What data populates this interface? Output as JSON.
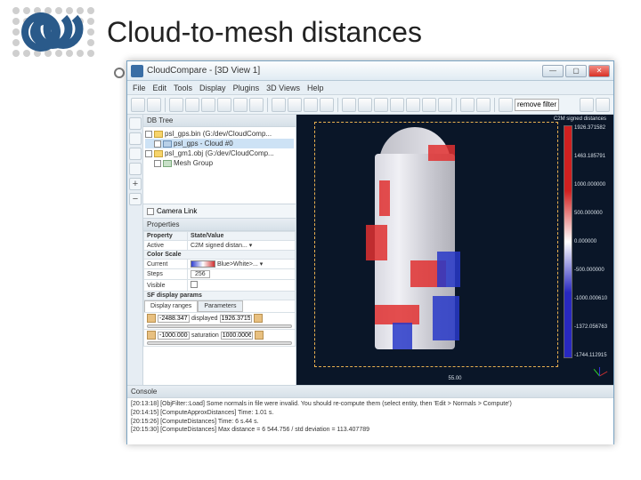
{
  "slide": {
    "title": "Cloud-to-mesh distances"
  },
  "window": {
    "title": "CloudCompare - [3D View 1]"
  },
  "menu": [
    "File",
    "Edit",
    "Tools",
    "Display",
    "Plugins",
    "3D Views",
    "Help"
  ],
  "toolbar_filter": "remove filter",
  "panels": {
    "tree_title": "DB Tree",
    "properties_title": "Properties",
    "console_title": "Console",
    "camera_link_label": "Camera Link"
  },
  "tree": [
    {
      "label": "psl_gps.bin (G:/dev/CloudComp...",
      "indent": 0,
      "icon": "folder"
    },
    {
      "label": "psl_gps - Cloud #0",
      "indent": 1,
      "icon": "cloud",
      "selected": true
    },
    {
      "label": "psl_gm1.obj (G:/dev/CloudComp...",
      "indent": 0,
      "icon": "folder"
    },
    {
      "label": "Mesh Group",
      "indent": 1,
      "icon": "mesh"
    }
  ],
  "properties": {
    "headers": [
      "Property",
      "State/Value"
    ],
    "active_label": "Active",
    "active_value": "C2M signed distan...",
    "colorscale_label": "Color Scale",
    "current_label": "Current",
    "current_value": "Blue>White>...",
    "steps_label": "Steps",
    "steps_value": "256",
    "visible_label": "Visible",
    "sf_display_label": "SF display params",
    "display_ranges_label": "Display ranges",
    "parameters_label": "Parameters",
    "range_low": "-2488.3471",
    "range_low_label": "displayed",
    "range_high": "1926.37158",
    "sat_low": "-1000.0006",
    "sat_label": "saturation",
    "sat_high": "1000.0006"
  },
  "viewport": {
    "sf_title": "C2M signed distances",
    "ruler": "55.00"
  },
  "scale_values": [
    "1926.371582",
    "1463.185791",
    "1000.000000",
    "500.000000",
    "0.000000",
    "-500.000000",
    "-1000.000610",
    "-1372.056763",
    "-1744.112915"
  ],
  "console_lines": [
    "[20:13:18] [ObjFilter::Load] Some normals in file were invalid. You should re-compute them (select entity, then 'Edit > Normals > Compute')",
    "[20:14:15] [ComputeApproxDistances] Time: 1.01 s.",
    "[20:15:26] [ComputeDistances] Time: 6 s.44 s.",
    "[20:15:30] [ComputeDistances] Max distance = 6 544.756 / std deviation = 113.407789"
  ]
}
